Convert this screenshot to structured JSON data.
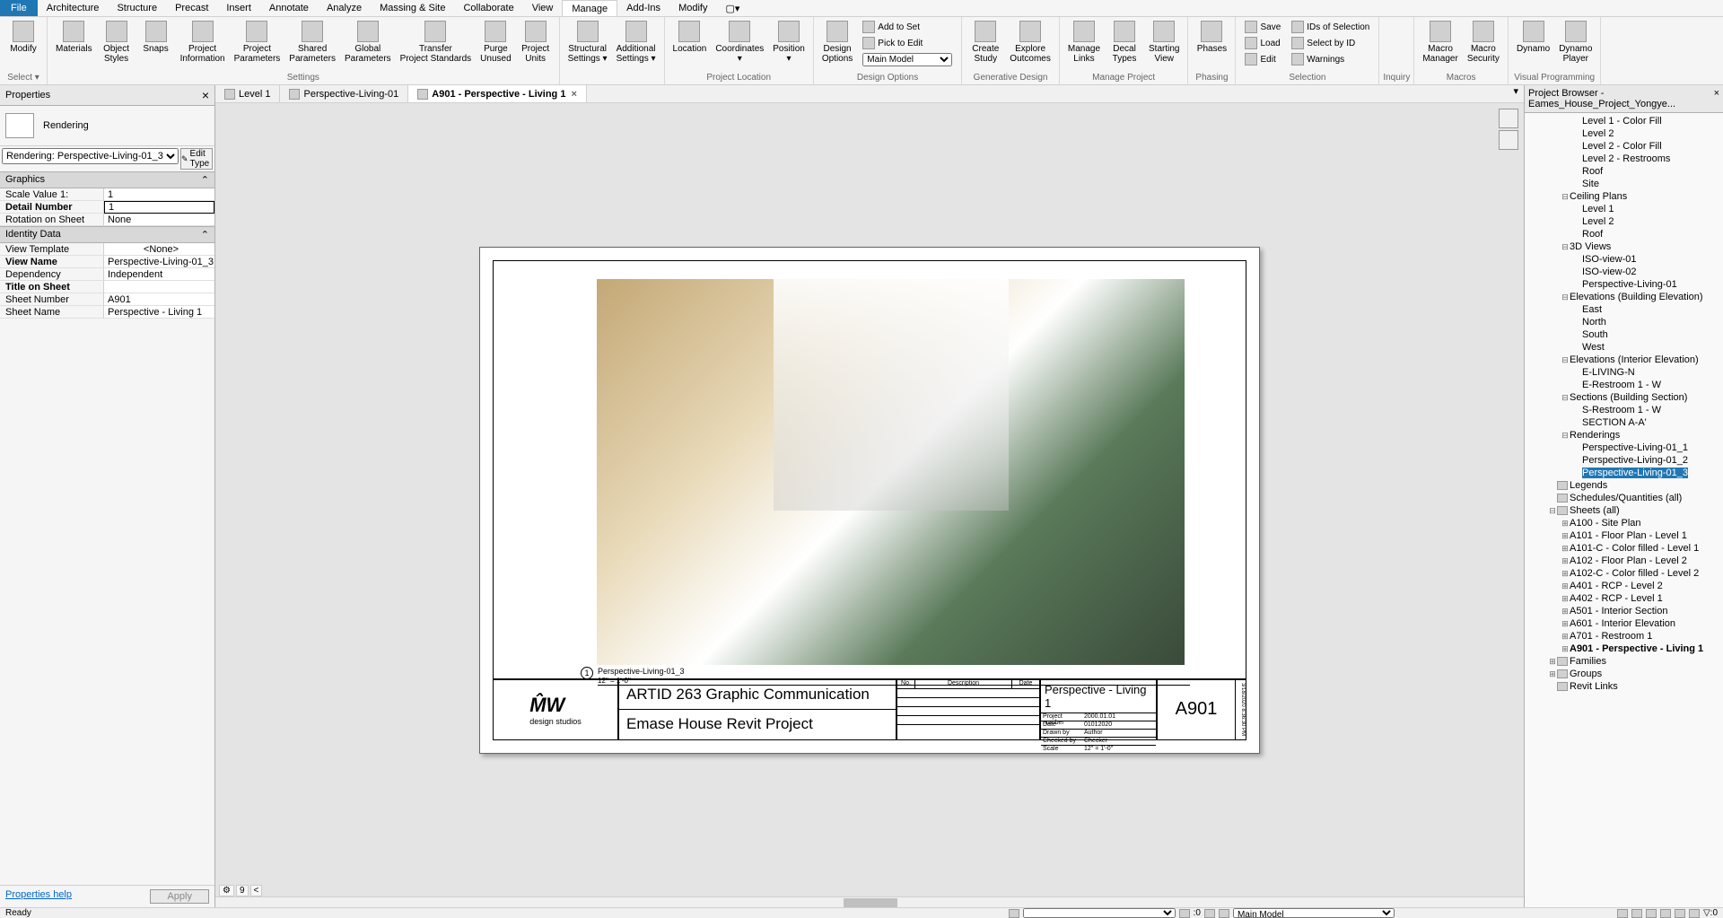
{
  "menu": {
    "items": [
      "File",
      "Architecture",
      "Structure",
      "Precast",
      "Insert",
      "Annotate",
      "Analyze",
      "Massing & Site",
      "Collaborate",
      "View",
      "Manage",
      "Add-Ins",
      "Modify"
    ],
    "active": 10
  },
  "ribbon": {
    "groups": [
      {
        "label": "Select ▾",
        "big": [
          {
            "txt": "Modify"
          }
        ]
      },
      {
        "label": "Settings",
        "big": [
          {
            "txt": "Materials"
          },
          {
            "txt": "Object\nStyles"
          },
          {
            "txt": "Snaps"
          },
          {
            "txt": "Project\nInformation"
          },
          {
            "txt": "Project\nParameters"
          },
          {
            "txt": "Shared\nParameters"
          },
          {
            "txt": "Global\nParameters"
          },
          {
            "txt": "Transfer\nProject Standards"
          },
          {
            "txt": "Purge\nUnused"
          },
          {
            "txt": "Project\nUnits"
          }
        ]
      },
      {
        "label": "",
        "big": [
          {
            "txt": "Structural\nSettings ▾"
          },
          {
            "txt": "Additional\nSettings ▾"
          }
        ]
      },
      {
        "label": "Project Location",
        "big": [
          {
            "txt": "Location"
          },
          {
            "txt": "Coordinates\n▾"
          },
          {
            "txt": "Position\n▾"
          }
        ]
      },
      {
        "label": "Design Options",
        "big": [
          {
            "txt": "Design\nOptions"
          }
        ],
        "small": [
          {
            "txt": "Add to Set"
          },
          {
            "txt": "Pick to Edit"
          },
          {
            "combo": "Main Model"
          }
        ]
      },
      {
        "label": "Generative Design",
        "big": [
          {
            "txt": "Create\nStudy"
          },
          {
            "txt": "Explore\nOutcomes"
          }
        ]
      },
      {
        "label": "Manage Project",
        "big": [
          {
            "txt": "Manage\nLinks"
          },
          {
            "txt": "Decal\nTypes"
          },
          {
            "txt": "Starting\nView"
          }
        ]
      },
      {
        "label": "Phasing",
        "big": [
          {
            "txt": "Phases"
          }
        ]
      },
      {
        "label": "Selection",
        "small": [
          {
            "txt": "Save"
          },
          {
            "txt": "Load"
          },
          {
            "txt": "Edit"
          }
        ],
        "small2": [
          {
            "txt": "IDs of Selection"
          },
          {
            "txt": "Select by ID"
          },
          {
            "txt": "Warnings"
          }
        ]
      },
      {
        "label": "Inquiry"
      },
      {
        "label": "Macros",
        "big": [
          {
            "txt": "Macro\nManager"
          },
          {
            "txt": "Macro\nSecurity"
          }
        ]
      },
      {
        "label": "Visual Programming",
        "big": [
          {
            "txt": "Dynamo"
          },
          {
            "txt": "Dynamo\nPlayer"
          }
        ]
      }
    ]
  },
  "tabs": [
    {
      "icon": true,
      "label": "Level 1",
      "active": false,
      "close": false
    },
    {
      "icon": true,
      "label": "Perspective-Living-01",
      "active": false,
      "close": false
    },
    {
      "icon": true,
      "label": "A901 - Perspective - Living 1",
      "active": true,
      "close": true
    }
  ],
  "properties": {
    "title": "Properties",
    "type_name": "Rendering",
    "instance": "Rendering: Perspective-Living-01_3",
    "edit_type": "Edit Type",
    "sections": [
      {
        "name": "Graphics",
        "rows": [
          {
            "k": "Scale Value    1:",
            "v": "1"
          },
          {
            "k": "Detail Number",
            "v": "1",
            "bold": true,
            "boxed": true
          },
          {
            "k": "Rotation on Sheet",
            "v": "None"
          }
        ]
      },
      {
        "name": "Identity Data",
        "rows": [
          {
            "k": "View Template",
            "v": "<None>",
            "center": true
          },
          {
            "k": "View Name",
            "v": "Perspective-Living-01_3",
            "bold": true
          },
          {
            "k": "Dependency",
            "v": "Independent"
          },
          {
            "k": "Title on Sheet",
            "v": "",
            "bold": true
          },
          {
            "k": "Sheet Number",
            "v": "A901"
          },
          {
            "k": "Sheet Name",
            "v": "Perspective - Living 1"
          }
        ]
      }
    ],
    "help": "Properties help",
    "apply": "Apply"
  },
  "sheet": {
    "view_name": "Perspective-Living-01_3",
    "view_scale": "12\" = 1'-0\"",
    "view_num": "1",
    "tb": {
      "logo_sub": "design   studios",
      "title1": "ARTID 263 Graphic Communication",
      "title2": "Emase House Revit Project",
      "rev_headers": [
        "No.",
        "Description",
        "Date"
      ],
      "sheet_name": "Perspective - Living 1",
      "sheet_num": "A901",
      "info": [
        [
          "Project number",
          "2000.01.01"
        ],
        [
          "Date",
          "01012020"
        ],
        [
          "Drawn by",
          "Author"
        ],
        [
          "Checked by",
          "Checker"
        ]
      ],
      "scale_label": "Scale",
      "scale_val": "12\" = 1'-0\"",
      "side_date": "3/18/2020 8:36:30 PM"
    }
  },
  "browser": {
    "title": "Project Browser - Eames_House_Project_Yongye...",
    "items": [
      {
        "i": 4,
        "l": "Level 1 - Color Fill"
      },
      {
        "i": 4,
        "l": "Level 2"
      },
      {
        "i": 4,
        "l": "Level 2 - Color Fill"
      },
      {
        "i": 4,
        "l": "Level 2 - Restrooms"
      },
      {
        "i": 4,
        "l": "Roof"
      },
      {
        "i": 4,
        "l": "Site"
      },
      {
        "i": 3,
        "l": "Ceiling Plans",
        "exp": "−"
      },
      {
        "i": 4,
        "l": "Level 1"
      },
      {
        "i": 4,
        "l": "Level 2"
      },
      {
        "i": 4,
        "l": "Roof"
      },
      {
        "i": 3,
        "l": "3D Views",
        "exp": "−"
      },
      {
        "i": 4,
        "l": "ISO-view-01"
      },
      {
        "i": 4,
        "l": "ISO-view-02"
      },
      {
        "i": 4,
        "l": "Perspective-Living-01"
      },
      {
        "i": 3,
        "l": "Elevations (Building Elevation)",
        "exp": "−"
      },
      {
        "i": 4,
        "l": "East"
      },
      {
        "i": 4,
        "l": "North"
      },
      {
        "i": 4,
        "l": "South"
      },
      {
        "i": 4,
        "l": "West"
      },
      {
        "i": 3,
        "l": "Elevations (Interior Elevation)",
        "exp": "−"
      },
      {
        "i": 4,
        "l": "E-LIVING-N"
      },
      {
        "i": 4,
        "l": "E-Restroom 1 - W"
      },
      {
        "i": 3,
        "l": "Sections (Building Section)",
        "exp": "−"
      },
      {
        "i": 4,
        "l": "S-Restroom 1 - W"
      },
      {
        "i": 4,
        "l": "SECTION A-A'"
      },
      {
        "i": 3,
        "l": "Renderings",
        "exp": "−"
      },
      {
        "i": 4,
        "l": "Perspective-Living-01_1"
      },
      {
        "i": 4,
        "l": "Perspective-Living-01_2"
      },
      {
        "i": 4,
        "l": "Perspective-Living-01_3",
        "sel": true
      },
      {
        "i": 2,
        "l": "Legends",
        "icon": true
      },
      {
        "i": 2,
        "l": "Schedules/Quantities (all)",
        "icon": true
      },
      {
        "i": 2,
        "l": "Sheets (all)",
        "exp": "−",
        "icon": true
      },
      {
        "i": 3,
        "l": "A100 - Site Plan",
        "exp": "+"
      },
      {
        "i": 3,
        "l": "A101 - Floor Plan - Level 1",
        "exp": "+"
      },
      {
        "i": 3,
        "l": "A101-C - Color filled - Level 1",
        "exp": "+"
      },
      {
        "i": 3,
        "l": "A102 - Floor Plan - Level 2",
        "exp": "+"
      },
      {
        "i": 3,
        "l": "A102-C - Color filled - Level 2",
        "exp": "+"
      },
      {
        "i": 3,
        "l": "A401 - RCP - Level 2",
        "exp": "+"
      },
      {
        "i": 3,
        "l": "A402 - RCP - Level 1",
        "exp": "+"
      },
      {
        "i": 3,
        "l": "A501 - Interior Section",
        "exp": "+"
      },
      {
        "i": 3,
        "l": "A601 - Interior Elevation",
        "exp": "+"
      },
      {
        "i": 3,
        "l": "A701 - Restroom 1",
        "exp": "+"
      },
      {
        "i": 3,
        "l": "A901 - Perspective - Living 1",
        "exp": "+",
        "bold": true
      },
      {
        "i": 2,
        "l": "Families",
        "exp": "+",
        "icon": true
      },
      {
        "i": 2,
        "l": "Groups",
        "exp": "+",
        "icon": true
      },
      {
        "i": 2,
        "l": "Revit Links",
        "icon": true
      }
    ]
  },
  "statusbar": {
    "left": "Ready",
    "workset": "Main Model",
    "filter_count": ":0",
    "end_badge": "▽:0"
  },
  "view_options": {
    "reveal": "⚙",
    "count": "9"
  }
}
